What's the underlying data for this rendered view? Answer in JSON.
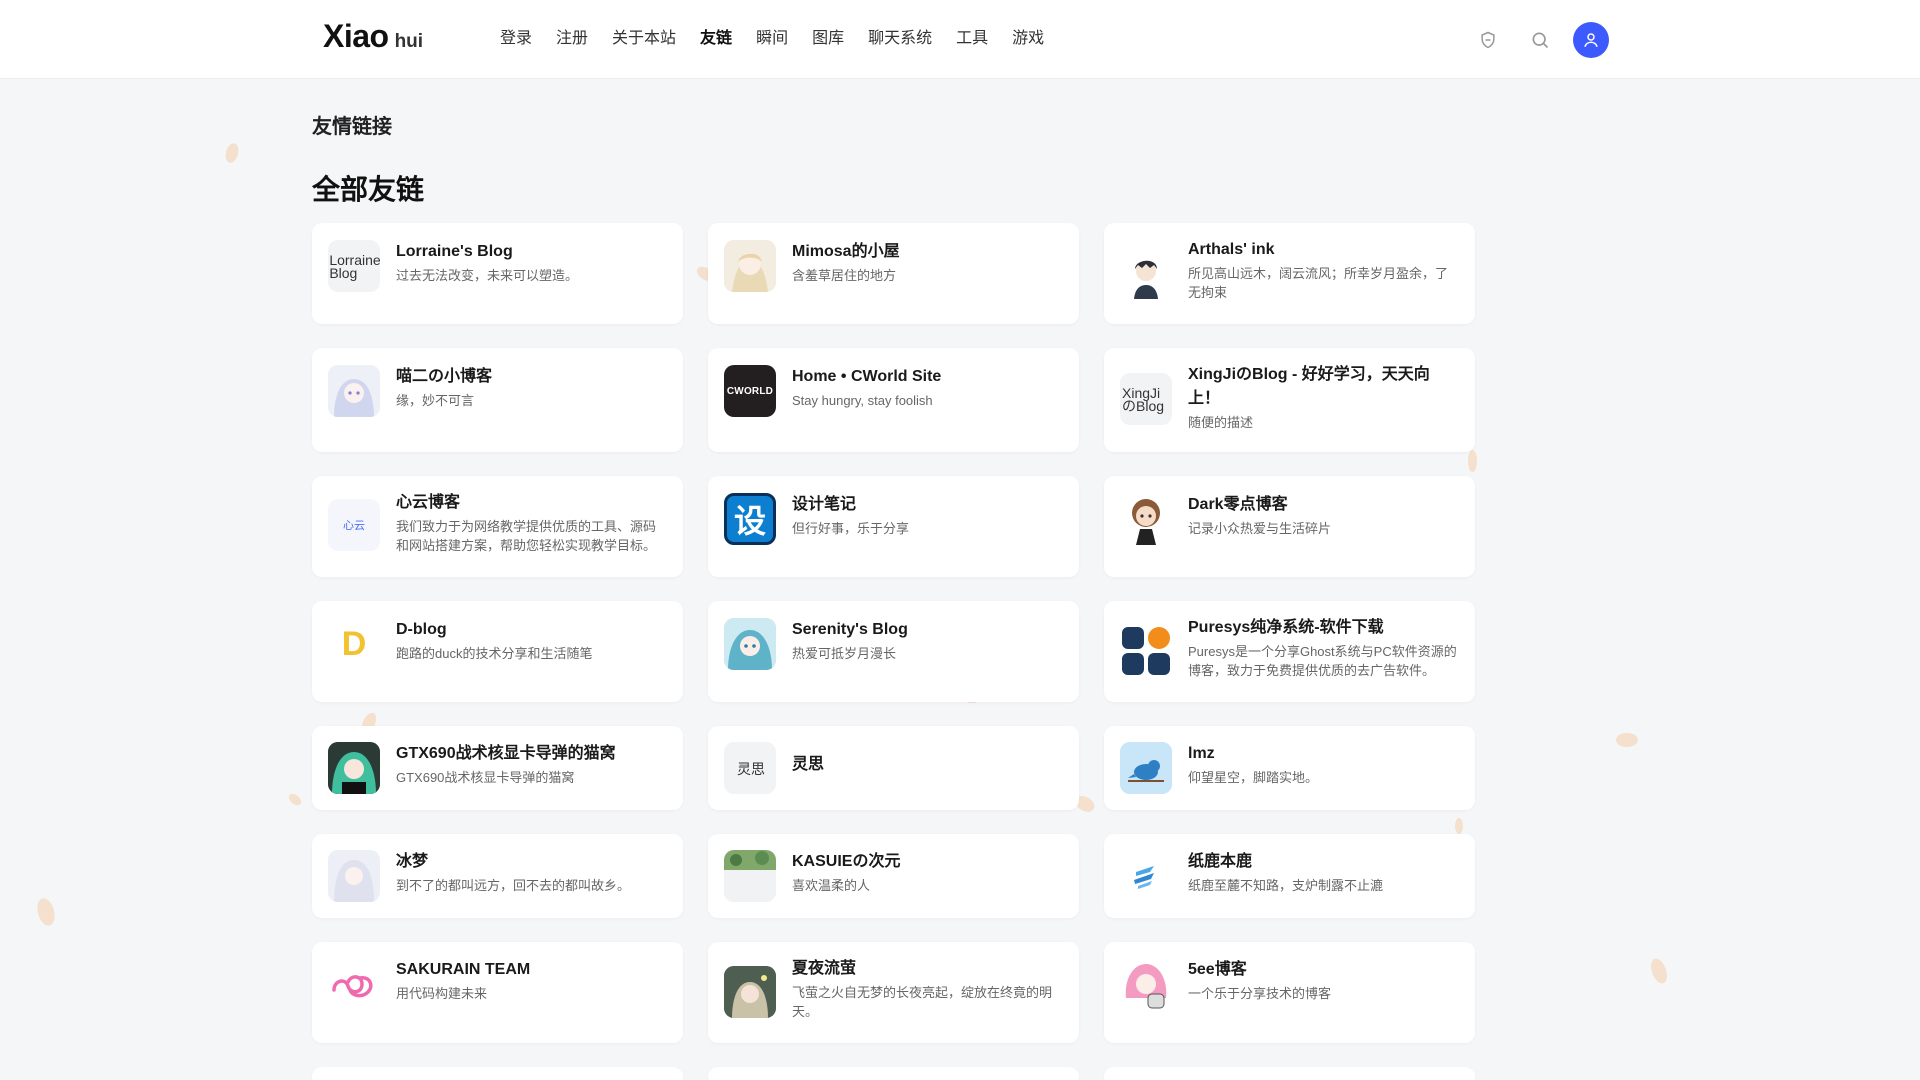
{
  "header": {
    "logo_main": "Xiao",
    "logo_sub": "hui",
    "nav": [
      "登录",
      "注册",
      "关于本站",
      "友链",
      "瞬间",
      "图库",
      "聊天系统",
      "工具",
      "游戏"
    ],
    "active_nav": "友链"
  },
  "page": {
    "breadcrumb": "友情链接",
    "section_title": "全部友链"
  },
  "links": [
    {
      "name": "Lorraine's Blog",
      "desc": "过去无法改变，未来可以塑造。",
      "avatar_alt": "Lorraine Blog"
    },
    {
      "name": "Mimosa的小屋",
      "desc": "含羞草居住的地方"
    },
    {
      "name": "Arthals' ink",
      "desc": "所见高山远木，阔云流风；所幸岁月盈余，了无拘束"
    },
    {
      "name": "喵二の小博客",
      "desc": "缘，妙不可言"
    },
    {
      "name": "Home • CWorld Site",
      "desc": "Stay hungry, stay foolish",
      "avatar_text": "CWORLD"
    },
    {
      "name": "XingJiのBlog - 好好学习，天天向上！",
      "desc": "随便的描述",
      "avatar_alt": "XingJi のBlog"
    },
    {
      "name": "心云博客",
      "desc": "我们致力于为网络教学提供优质的工具、源码和网站搭建方案，帮助您轻松实现教学目标。",
      "avatar_text": "心云"
    },
    {
      "name": "设计笔记",
      "desc": "但行好事，乐于分享",
      "avatar_text": "设"
    },
    {
      "name": "Dark零点博客",
      "desc": "记录小众热爱与生活碎片"
    },
    {
      "name": "D-blog",
      "desc": "跑路的duck的技术分享和生活随笔",
      "avatar_text": "D"
    },
    {
      "name": "Serenity's Blog",
      "desc": "热爱可抵岁月漫长"
    },
    {
      "name": "Puresys纯净系统-软件下载",
      "desc": "Puresys是一个分享Ghost系统与PC软件资源的博客，致力于免费提供优质的去广告软件。"
    },
    {
      "name": "GTX690战术核显卡导弹的猫窝",
      "desc": "GTX690战术核显卡导弹的猫窝"
    },
    {
      "name": "灵思",
      "desc": "",
      "avatar_alt": "灵思"
    },
    {
      "name": "lmz",
      "desc": "仰望星空，脚踏实地。"
    },
    {
      "name": "冰梦",
      "desc": "到不了的都叫远方，回不去的都叫故乡。"
    },
    {
      "name": "KASUIEの次元",
      "desc": "喜欢温柔的人"
    },
    {
      "name": "纸鹿本鹿",
      "desc": "纸鹿至麓不知路，支炉制露不止漉"
    },
    {
      "name": "SAKURAIN TEAM",
      "desc": "用代码构建未来"
    },
    {
      "name": "夏夜流萤",
      "desc": "飞萤之火自无梦的长夜亮起，绽放在终竟的明天。"
    },
    {
      "name": "5ee博客",
      "desc": "一个乐于分享技术的博客"
    }
  ],
  "colors": {
    "accent": "#3d5afe",
    "background": "#f5f6f8",
    "card": "#ffffff"
  }
}
